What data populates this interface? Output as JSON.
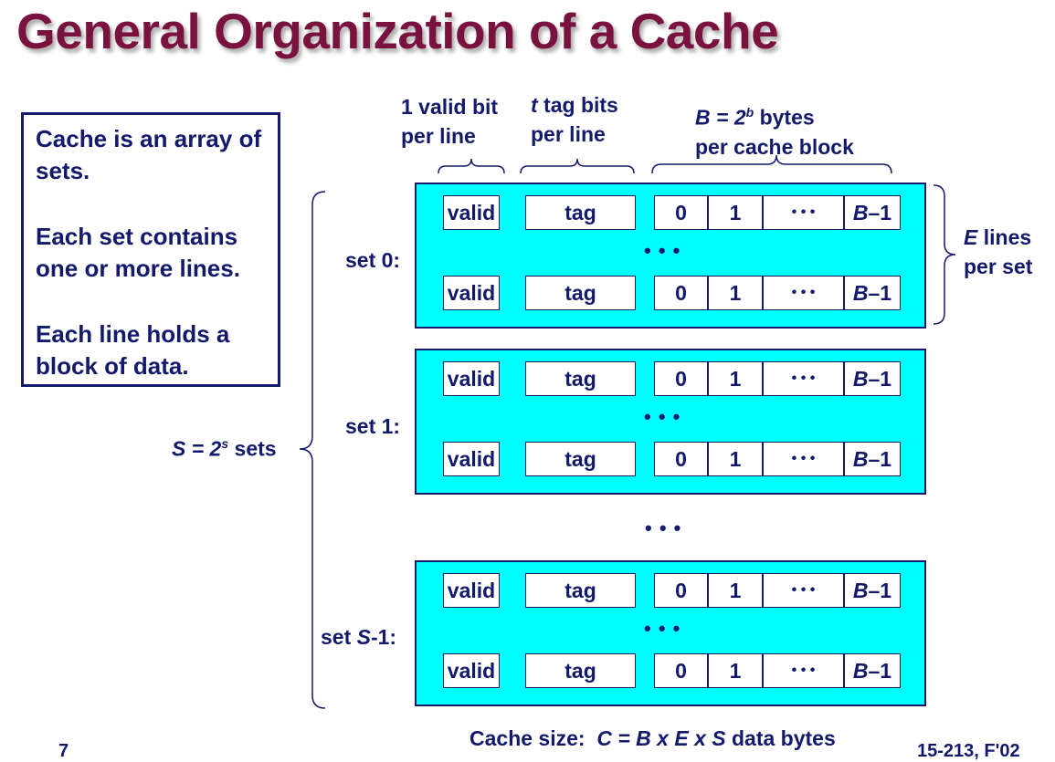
{
  "title": "General Organization of a Cache",
  "info": {
    "p1": "Cache is an array of sets.",
    "p2": "Each set contains one or more lines.",
    "p3": "Each line holds a block of data."
  },
  "headers": {
    "valid_1": "1 valid bit",
    "valid_2": "per line",
    "tag_italic": "t",
    "tag_1": " tag bits",
    "tag_2": "per line",
    "block_B": "B = 2",
    "block_exp": "b",
    "block_1": " bytes",
    "block_2": "per cache block"
  },
  "sets_label": {
    "prefix": "S = 2",
    "exp": "s",
    "suffix": " sets"
  },
  "lines_label": {
    "E": "E",
    "line1": " lines",
    "line2": "per set"
  },
  "line_cells": {
    "valid": "valid",
    "tag": "tag",
    "b0": "0",
    "b1": "1",
    "dots": "• • •",
    "last_italic": "B",
    "last_rest": "–1"
  },
  "row_dots": "• • •",
  "between_sets_dots": "• • •",
  "sets": [
    {
      "label": "set 0:"
    },
    {
      "label": "set 1:"
    },
    {
      "label_prefix": "set ",
      "label_italic": "S",
      "label_suffix": "-1:"
    }
  ],
  "footer": {
    "prefix": "Cache size:  ",
    "formula": "C = B x E x S",
    "suffix": " data bytes"
  },
  "corner_left": "7",
  "corner_right": "15-213, F'02"
}
